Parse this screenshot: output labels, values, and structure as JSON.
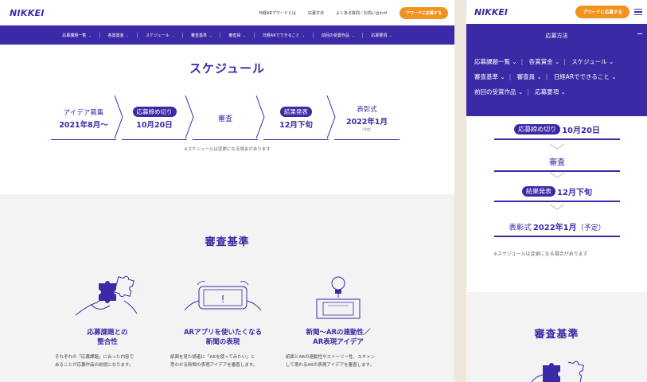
{
  "brand": {
    "logo": "NIKKEI",
    "primary": "#3a2aa6",
    "accent": "#f0931f"
  },
  "header": {
    "links": [
      "日経ARアワードとは",
      "応募方法",
      "よくある質問／お問い合わせ"
    ],
    "cta": "アワードに応募する"
  },
  "navbar": [
    "応募課題一覧",
    "各賞賞金",
    "スケジュール",
    "審査基準",
    "審査員",
    "日経ARでできること",
    "前回の受賞作品",
    "応募要項"
  ],
  "schedule": {
    "title": "スケジュール",
    "steps": [
      {
        "line1": "アイデア募集",
        "line2": "2021年8月〜"
      },
      {
        "pill": "応募締め切り",
        "line2": "10月20日"
      },
      {
        "solo": "審査"
      },
      {
        "pill": "結果発表",
        "line2": "12月下旬"
      },
      {
        "line1": "表彰式",
        "line2": "2022年1月",
        "tiny": "（予定）"
      }
    ],
    "note": "※スケジュールは変更になる場合があります"
  },
  "criteria": {
    "title": "審査基準",
    "items": [
      {
        "title1": "応募課題との",
        "title2": "整合性",
        "desc1": "それぞれの「応募課題」に合った内容で",
        "desc2": "あることが応募作品の前提になります。"
      },
      {
        "title1": "ARアプリを使いたくなる",
        "title2": "新聞の表現",
        "desc1": "紙面を見た読者に「ARを使ってみたい」と",
        "desc2": "思わせる新聞の表現アイデアを審査します。"
      },
      {
        "title1": "新聞〜ARの連動性／",
        "title2": "AR表現アイデア",
        "desc1": "紙面とARの連動性やストーリー性、スキャン",
        "desc2": "して現れるARの表現アイデアを審査します。"
      }
    ]
  },
  "mobile": {
    "menu_title": "応募方法",
    "links": [
      [
        "応募課題一覧",
        "各賞賞金",
        "スケジュール"
      ],
      [
        "審査基準",
        "審査員",
        "日経ARでできること"
      ],
      [
        "前回の受賞作品",
        "応募要項"
      ]
    ],
    "steps": [
      {
        "pill": "応募締め切り",
        "big": "10月20日"
      },
      {
        "solo": "審査"
      },
      {
        "pill": "結果発表",
        "big": "12月下旬"
      },
      {
        "text": "表彰式",
        "big": "2022年1月",
        "suffix": "（予定）"
      }
    ],
    "note": "※スケジュールは変更になる場合があります",
    "criteria_title": "審査基準"
  }
}
